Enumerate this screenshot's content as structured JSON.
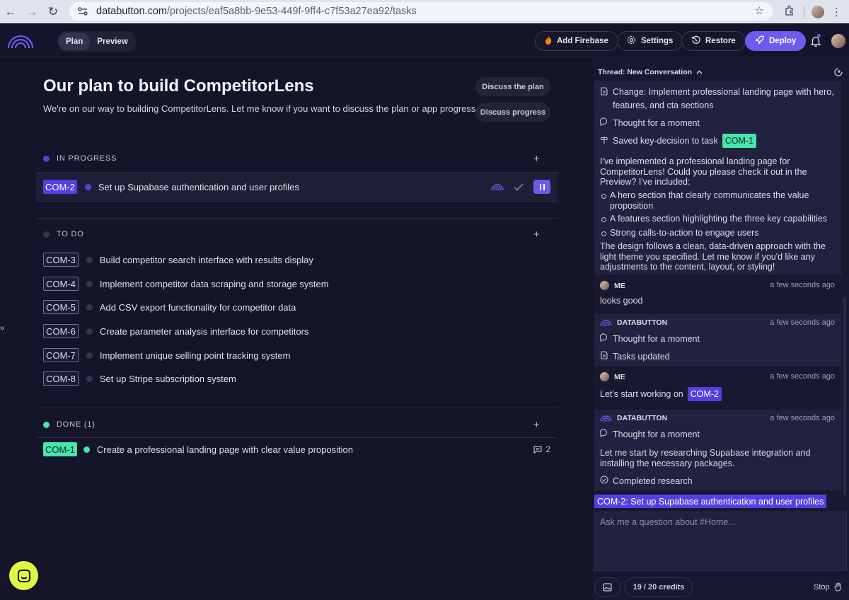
{
  "browser": {
    "url_domain": "databutton.com",
    "url_path": "/projects/eaf5a8bb-9e53-449f-9ff4-c7f53a27ea92/tasks"
  },
  "header": {
    "tabs": [
      {
        "label": "Plan",
        "active": true
      },
      {
        "label": "Preview",
        "active": false
      }
    ],
    "add_firebase": "Add Firebase",
    "settings": "Settings",
    "restore": "Restore",
    "deploy": "Deploy"
  },
  "plan": {
    "title": "Our plan to build CompetitorLens",
    "subtitle": "We're on our way to building CompetitorLens. Let me know if you want to discuss the plan or app progress.",
    "discuss_plan": "Discuss the plan",
    "discuss_progress": "Discuss progress",
    "sections": {
      "in_progress": {
        "label": "IN PROGRESS",
        "tasks": [
          {
            "id": "COM-2",
            "text": "Set up Supabase authentication and user profiles"
          }
        ]
      },
      "todo": {
        "label": "TO DO",
        "tasks": [
          {
            "id": "COM-3",
            "text": "Build competitor search interface with results display"
          },
          {
            "id": "COM-4",
            "text": "Implement competitor data scraping and storage system"
          },
          {
            "id": "COM-5",
            "text": "Add CSV export functionality for competitor data"
          },
          {
            "id": "COM-6",
            "text": "Create parameter analysis interface for competitors"
          },
          {
            "id": "COM-7",
            "text": "Implement unique selling point tracking system"
          },
          {
            "id": "COM-8",
            "text": "Set up Stripe subscription system"
          }
        ]
      },
      "done": {
        "label": "DONE (1)",
        "tasks": [
          {
            "id": "COM-1",
            "text": "Create a professional landing page with clear value proposition",
            "comments": "2"
          }
        ]
      }
    }
  },
  "chat": {
    "thread_title": "Thread: New Conversation",
    "change_line": "Change: Implement professional landing page with hero, features, and cta sections",
    "thought": "Thought for a moment",
    "saved_decision": "Saved key-decision to task",
    "saved_decision_tag": "COM-1",
    "intro": "I've implemented a professional landing page for CompetitorLens! Could you please check it out in the Preview? I've included:",
    "bullets": [
      "A hero section that clearly communicates the value proposition",
      "A features section highlighting the three key capabilities",
      "Strong calls-to-action to engage users"
    ],
    "outro": "The design follows a clean, data-driven approach with the light theme you specified. Let me know if you'd like any adjustments to the content, layout, or styling!",
    "me_label": "ME",
    "bot_label": "DATABUTTON",
    "time": "a few seconds ago",
    "me_msg1": "looks good",
    "tasks_updated": "Tasks updated",
    "me_msg2": "Let's start working on",
    "me_msg2_tag": "COM-2",
    "research_text": "Let me start by researching Supabase integration and installing the necessary packages.",
    "completed_research": "Completed research",
    "task_banner": "COM-2: Set up Supabase authentication and user profiles",
    "input_placeholder": "Ask me a question about #Home...",
    "credits": "19 / 20 credits",
    "stop": "Stop"
  },
  "colors": {
    "accent": "#6d5bf0",
    "in_progress": "#5340e0",
    "done": "#46e6ad",
    "background": "#14142a"
  }
}
